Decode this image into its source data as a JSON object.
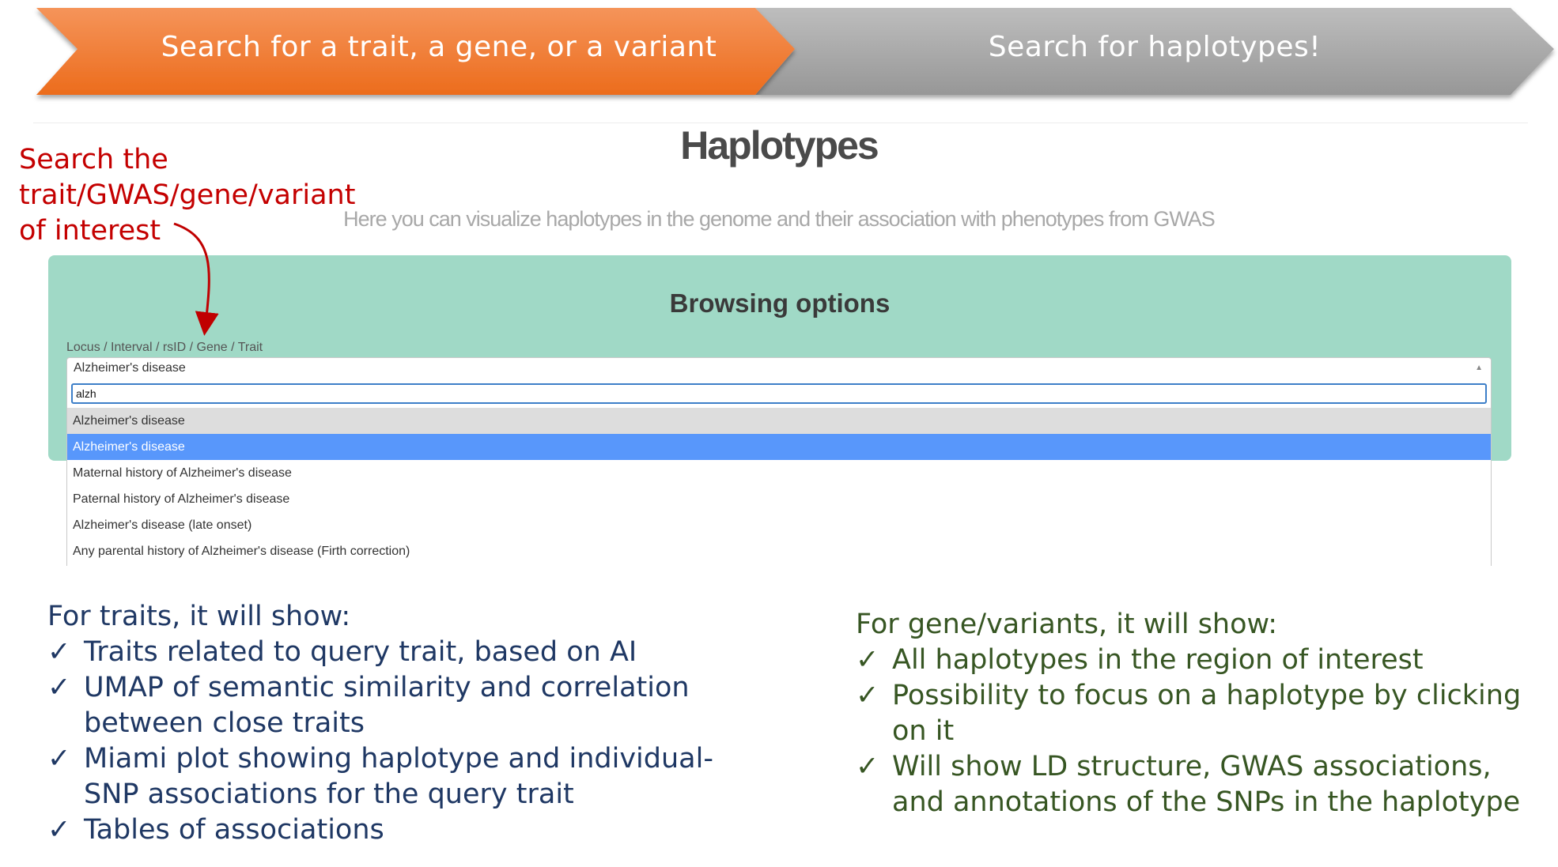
{
  "banner": {
    "step1": "Search for a trait, a gene, or a variant",
    "step2": "Search for haplotypes!",
    "colors": {
      "step1": "#f07a2b",
      "step2": "#a8a8a8"
    }
  },
  "page": {
    "title": "Haplotypes",
    "subtitle": "Here you can visualize haplotypes in the genome and their association with phenotypes from GWAS"
  },
  "annotation": {
    "lines": [
      "Search the",
      "trait/GWAS/gene/variant",
      "of interest"
    ],
    "color": "#c40000"
  },
  "options": {
    "title": "Browsing options",
    "field_label": "Locus / Interval / rsID / Gene / Trait",
    "selected": "Alzheimer's disease",
    "search_value": "alzh",
    "results": [
      "Alzheimer's disease",
      "Alzheimer's disease",
      "Maternal history of Alzheimer's disease",
      "Paternal history of Alzheimer's disease",
      "Alzheimer's disease (late onset)",
      "Any parental history of Alzheimer's disease (Firth correction)"
    ],
    "panel_color": "#a0d9c6",
    "highlight_color": "#5897fb"
  },
  "traits_list": {
    "prefix": "For",
    "keyword": "traits",
    "suffix": ", it will show:",
    "check": "✓",
    "items": [
      "Traits related to query trait, based on AI",
      "UMAP of semantic similarity and correlation between close traits",
      "Miami plot showing haplotype and individual-SNP associations for the query trait",
      "Tables of associations"
    ],
    "color": "#1f3864"
  },
  "genes_list": {
    "prefix": "For",
    "keyword": "gene/variants",
    "suffix": ", it will show:",
    "check": "✓",
    "items": [
      "All haplotypes in the region of interest",
      "Possibility to focus on a haplotype by clicking on it",
      "Will show LD structure, GWAS associations, and annotations of the SNPs in the haplotype"
    ],
    "color": "#375623"
  }
}
